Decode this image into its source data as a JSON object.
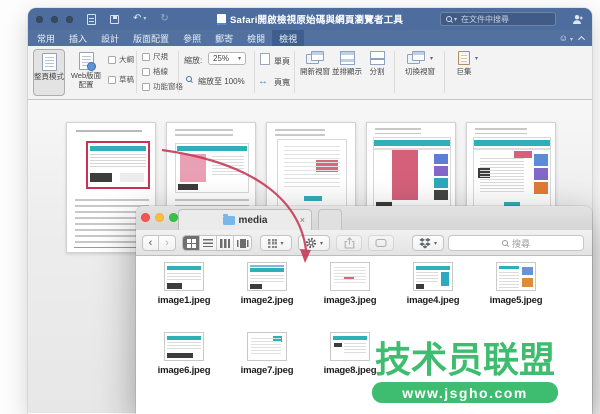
{
  "word": {
    "title": "Safari開啟檢視原始碼與網頁瀏覽者工具",
    "search_placeholder": "在文件中搜尋",
    "tabs": [
      "常用",
      "插入",
      "設計",
      "版面配置",
      "參照",
      "郵寄",
      "檢閱",
      "檢視"
    ],
    "active_tab": "檢視",
    "ribbon": {
      "view_modes": [
        {
          "label": "整頁模式",
          "selected": true
        },
        {
          "label": "Web版面配置",
          "selected": false
        }
      ],
      "outline_label": "大綱",
      "draft_label": "草稿",
      "ruler_label": "尺規",
      "gridlines_label": "格線",
      "nav_pane_label": "功能窗格",
      "zoom_label": "縮放:",
      "zoom_value": "25%",
      "zoom_100_label": "縮放至 100%",
      "one_page_label": "單頁",
      "page_width_label": "頁寬",
      "new_window_label": "開新視窗",
      "arrange_all_label": "並排顯示",
      "split_label": "分割",
      "switch_windows_label": "切換視窗",
      "macros_label": "巨集"
    },
    "page_count": 5
  },
  "finder": {
    "tab_title": "media",
    "close_tab": "×",
    "back": "‹",
    "forward": "›",
    "search_placeholder": "搜尋",
    "files": [
      "image1.jpeg",
      "image2.jpeg",
      "image3.jpeg",
      "image4.jpeg",
      "image5.jpeg",
      "image6.jpeg",
      "image7.jpeg",
      "image8.jpeg"
    ]
  },
  "watermark": {
    "title": "技术员联盟",
    "url": "www.jsgho.com"
  },
  "colors": {
    "word_blue": "#4d6d9f",
    "teal_accent": "#2fb0b6",
    "highlight_red": "#cf3154",
    "watermark_green": "#3ebc6f"
  }
}
